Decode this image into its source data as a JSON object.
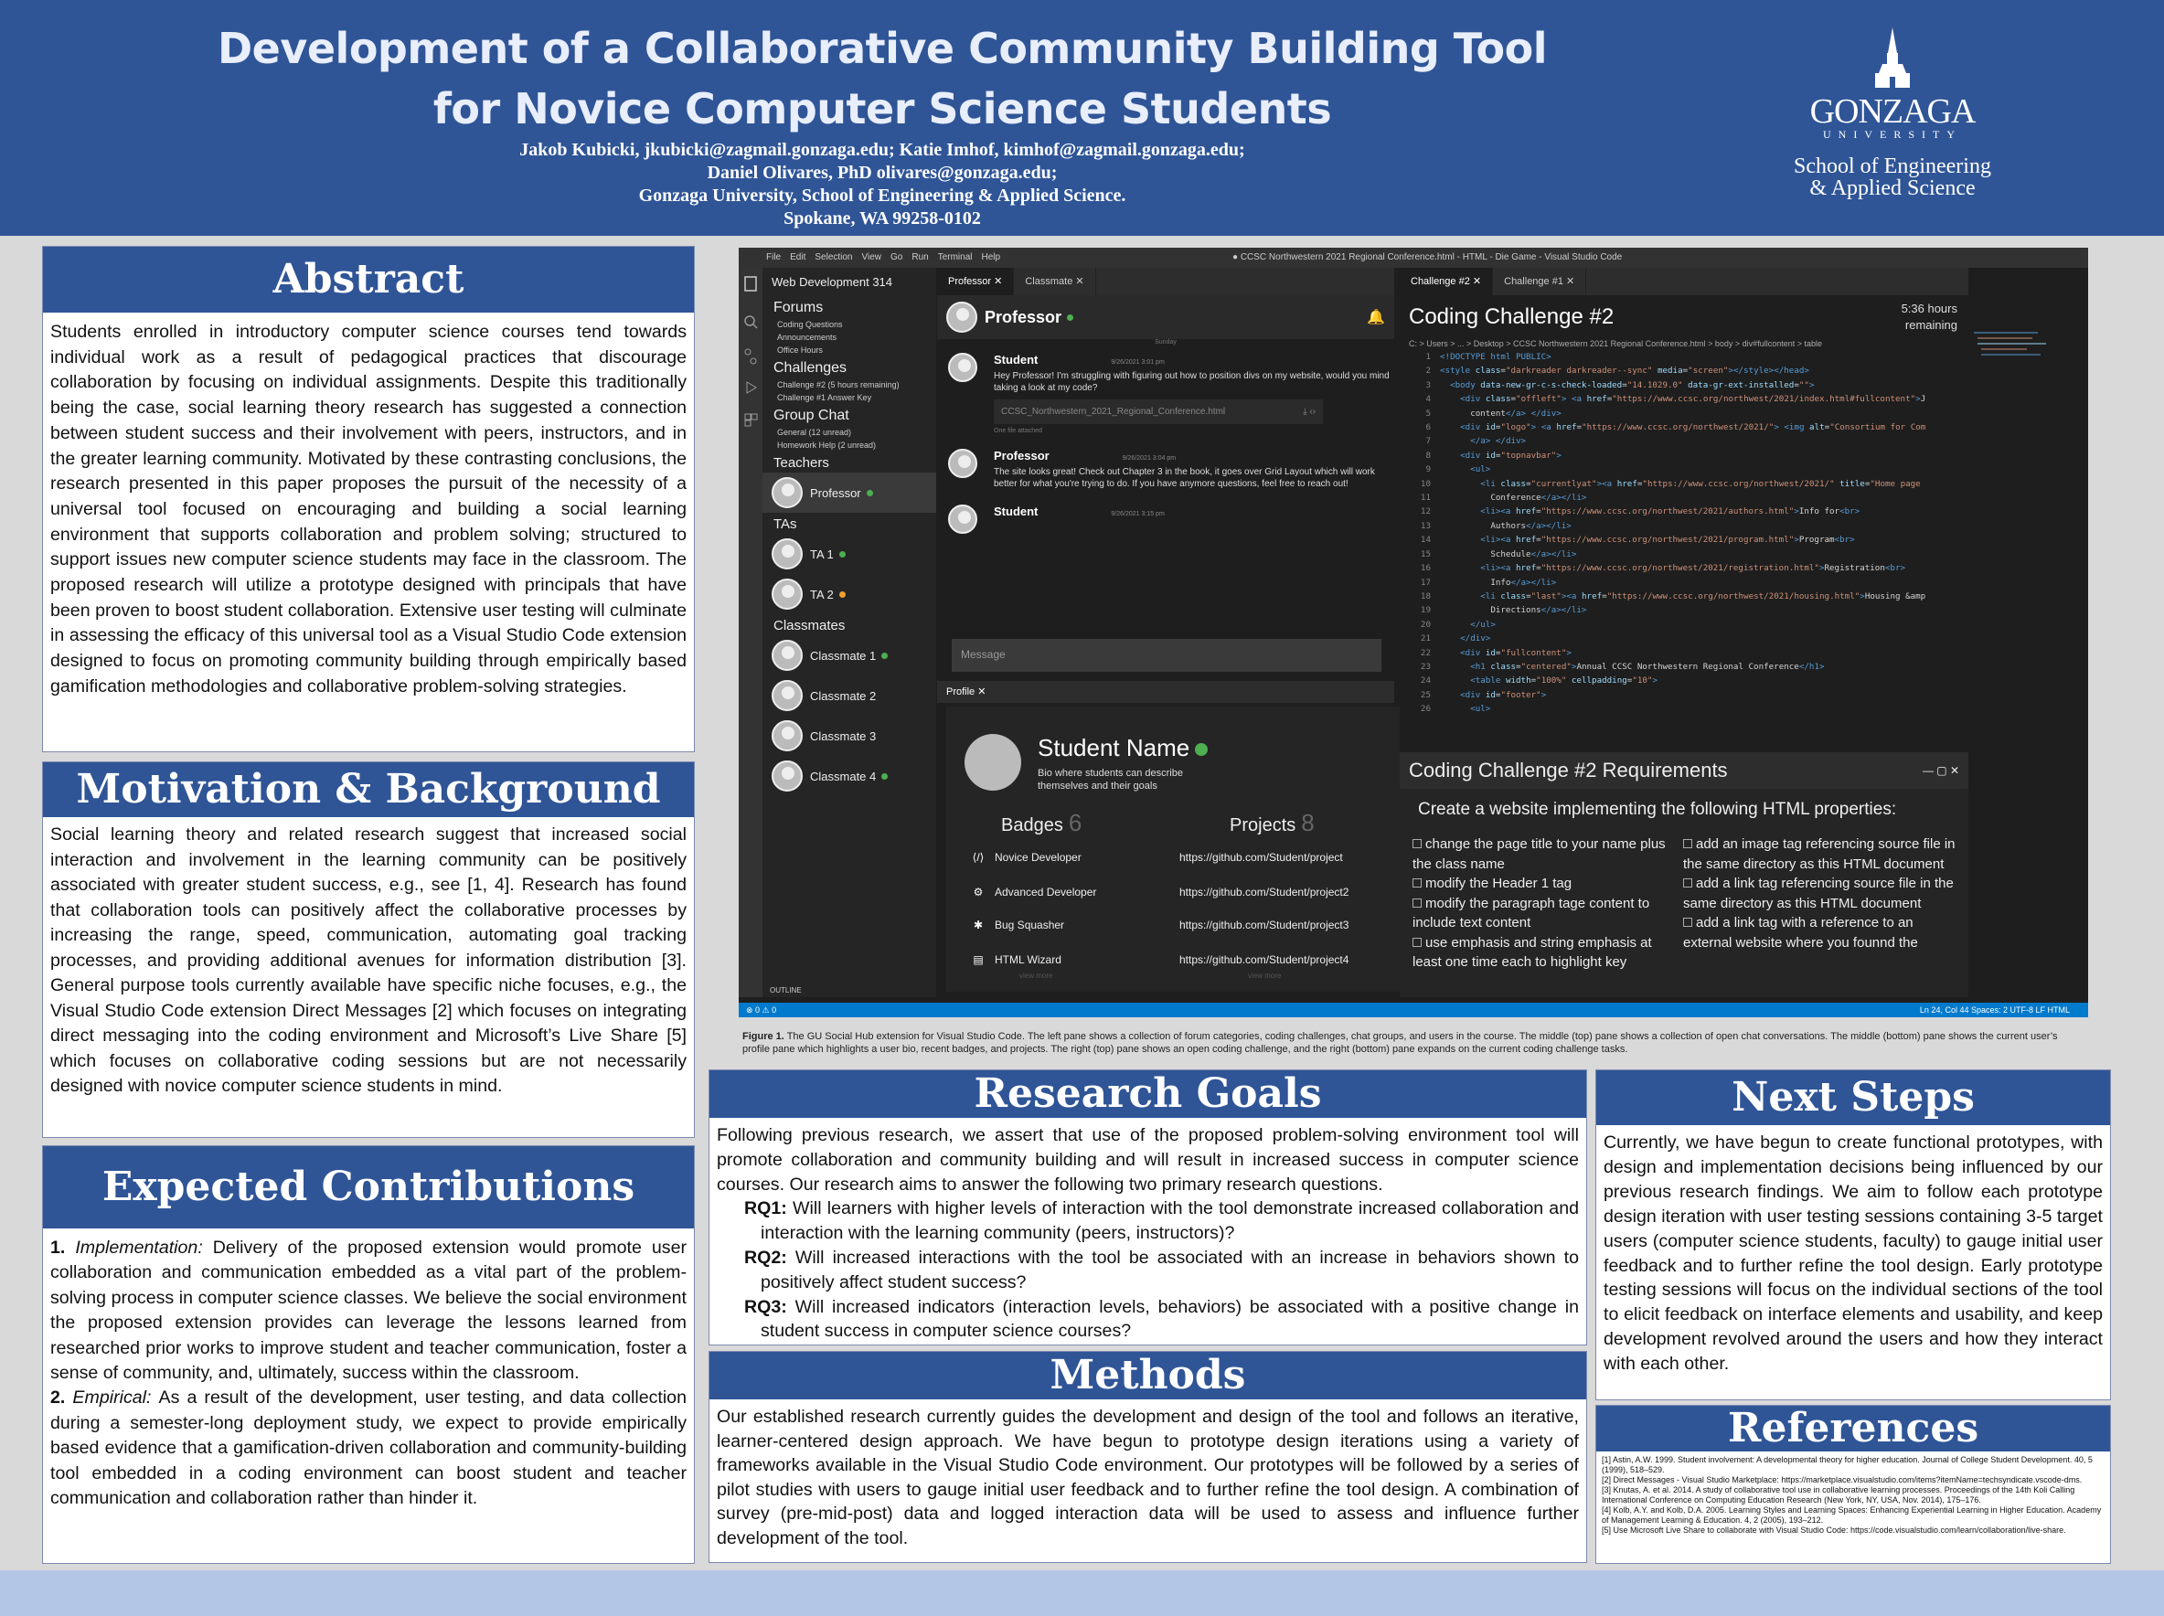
{
  "header": {
    "title_line1": "Development of a Collaborative Community Building Tool",
    "title_line2": "for Novice Computer Science Students",
    "authors_line1": "Jakob Kubicki, jkubicki@zagmail.gonzaga.edu; Katie Imhof, kimhof@zagmail.gonzaga.edu;",
    "authors_line2": "Daniel Olivares, PhD olivares@gonzaga.edu;",
    "authors_line3": "Gonzaga University, School of Engineering & Applied Science.",
    "authors_line4": "Spokane, WA 99258-0102",
    "logo_word": "GONZAGA",
    "logo_university": "UNIVERSITY",
    "logo_school_line1": "School of Engineering",
    "logo_school_line2": "& Applied Science"
  },
  "abstract": {
    "heading": "Abstract",
    "body": "Students enrolled in introductory computer science courses tend towards individual work as a result of pedagogical practices that discourage collaboration by focusing on individual assignments. Despite this traditionally being the case, social learning theory research has suggested a connection between student success and their involvement with peers, instructors, and in the greater learning community. Motivated by these contrasting conclusions, the research presented in this paper proposes the pursuit of the necessity of a universal tool focused on encouraging and building a social learning environment that supports collaboration and problem solving; structured to support issues new computer science students may face in the classroom. The proposed research will utilize a prototype designed with principals that have been proven to boost student collaboration. Extensive user testing will culminate in assessing the efficacy of this universal tool as a Visual Studio Code extension designed to focus on promoting community building through empirically based gamification methodologies and collaborative problem-solving strategies."
  },
  "motivation": {
    "heading": "Motivation & Background",
    "body": "Social learning theory and related research suggest that increased social interaction and involvement in the learning community can be positively associated with greater student success, e.g., see [1, 4]. Research has found that collaboration tools can positively affect the collaborative processes by increasing the range, speed, communication, automating goal tracking processes, and providing additional avenues for information distribution [3]. General purpose tools currently available have specific niche focuses, e.g., the Visual Studio Code extension Direct Messages [2] which focuses on integrating direct messaging into the coding environment and Microsoft’s Live Share [5] which focuses on collaborative coding sessions but are not necessarily designed with novice computer science students in mind."
  },
  "contributions": {
    "heading": "Expected Contributions",
    "item1_num": "1.",
    "item1_label": "Implementation:",
    "item1_text": " Delivery of the proposed extension would promote user collaboration and communication embedded as a vital part of the problem-solving process in computer science classes. We believe the social environment the proposed extension provides can leverage the lessons learned from researched prior works to improve student and teacher communication, foster a sense of community, and, ultimately, success within the classroom.",
    "item2_num": "2.",
    "item2_label": "Empirical: ",
    "item2_text": "As a result of the development, user testing, and data collection during a semester-long deployment study, we expect to provide empirically based evidence that a gamification-driven collaboration and community-building tool embedded in a coding environment can boost student and teacher communication and collaboration rather than hinder it."
  },
  "goals": {
    "heading": "Research Goals",
    "intro": "Following previous research, we assert that use of the proposed problem-solving environment tool will promote collaboration and community building and will result in increased success in computer science courses. Our research aims to answer the following two primary research questions.",
    "rq1_label": "RQ1:",
    "rq1_text": " Will learners with higher levels of interaction with the tool demonstrate increased collaboration and interaction with the learning community (peers, instructors)?",
    "rq2_label": "RQ2:",
    "rq2_text": " Will increased interactions with the tool be associated with an increase in behaviors shown to positively affect student success?",
    "rq3_label": "RQ3:",
    "rq3_text": " Will increased indicators (interaction levels, behaviors) be associated with a positive change in student success in computer science courses?"
  },
  "methods": {
    "heading": "Methods",
    "body": "Our established research currently guides the development and design of the tool and follows an iterative, learner-centered design approach. We have begun to prototype design iterations using a variety of frameworks available in the Visual Studio Code environment. Our prototypes will be followed by a series of pilot studies with users to gauge initial user feedback and to further refine the tool design. A combination of survey (pre-mid-post) data and logged interaction data will be used to assess and influence further development of the tool."
  },
  "next_steps": {
    "heading": "Next Steps",
    "body": "Currently, we have begun to create functional prototypes, with design and implementation decisions being influenced by our previous research findings. We aim to follow each prototype design iteration with user testing sessions containing 3-5 target users (computer science students, faculty) to gauge initial user feedback and to further refine the tool design. Early prototype testing sessions will focus on the individual sections of the tool to elicit feedback on interface elements and usability, and keep development revolved around the users and how they interact with each other."
  },
  "references": {
    "heading": "References",
    "items": [
      "[1] Astin, A.W. 1999. Student involvement: A developmental theory for higher education. Journal of College Student Development. 40, 5 (1999), 518–529.",
      "[2] Direct Messages - Visual Studio Marketplace: https://marketplace.visualstudio.com/items?itemName=techsyndicate.vscode-dms.",
      "[3] Knutas, A. et al. 2014. A study of collaborative tool use in collaborative learning processes. Proceedings of the 14th Koli Calling International Conference on Computing Education Research (New York, NY, USA, Nov. 2014), 175–176.",
      "[4] Kolb, A.Y. and Kolb, D.A. 2005. Learning Styles and Learning Spaces: Enhancing Experiential Learning in Higher Education. Academy of Management Learning & Education. 4, 2 (2005), 193–212.",
      "[5] Use Microsoft Live Share to collaborate with Visual Studio Code: https://code.visualstudio.com/learn/collaboration/live-share."
    ]
  },
  "figure": {
    "caption_label": "Figure 1.",
    "caption_text": " The GU Social Hub extension for Visual Studio Code. The left pane shows a collection of forum categories, coding challenges, chat groups, and users in the course. The middle (top) pane shows a collection of open chat conversations. The middle (bottom) pane shows the current user’s profile pane which highlights a user bio, recent badges, and projects. The right (top) pane shows an open coding challenge, and the right (bottom) pane expands on the current coding challenge tasks.",
    "menu": [
      "File",
      "Edit",
      "Selection",
      "View",
      "Go",
      "Run",
      "Terminal",
      "Help"
    ],
    "window_title": "● CCSC Northwestern 2021 Regional Conference.html - HTML - Die Game - Visual Studio Code",
    "sidebar": {
      "title": "Web Development 314",
      "forums": "Forums",
      "forum_items": [
        "Coding Questions",
        "Announcements",
        "Office Hours"
      ],
      "challenges": "Challenges",
      "challenge_items": [
        "Challenge #2 (5 hours remaining)",
        "Challenge #1 Answer Key"
      ],
      "group_chat": "Group Chat",
      "group_items": [
        "General (12 unread)",
        "Homework Help (2 unread)"
      ],
      "teachers": "Teachers",
      "teacher_name": "Professor",
      "tas": "TAs",
      "ta1": "TA 1",
      "ta2": "TA 2",
      "classmates": "Classmates",
      "classmate_items": [
        "Classmate 1",
        "Classmate 2",
        "Classmate 3",
        "Classmate 4"
      ]
    },
    "chat": {
      "tab1": "Professor",
      "tab2": "Classmate",
      "header_name": "Professor",
      "day": "Sunday",
      "msg1_name": "Student",
      "msg1_time": "9/26/2021 3:01 pm",
      "msg1_text": "Hey Professor! I'm struggling with figuring out how to position divs on my website, would you mind taking a look at my code?",
      "msg1_file": "CCSC_Northwestern_2021_Regional_Conference.html",
      "msg1_attached": "One file attached",
      "msg2_name": "Professor",
      "msg2_time": "9/26/2021 3:04 pm",
      "msg2_text": "The site looks great! Check out Chapter 3 in the book, it goes over Grid Layout which will work better for what you're trying to do. If you have anymore questions, feel free to reach out!",
      "msg3_name": "Student",
      "msg3_time": "9/26/2021 3:15 pm",
      "input_placeholder": "Message"
    },
    "profile": {
      "tab": "Profile",
      "name": "Student Name",
      "bio": "Bio where students can describe themselves and their goals",
      "badges_label": "Badges",
      "badges_count": "6",
      "projects_label": "Projects",
      "projects_count": "8",
      "badges": [
        "Novice Developer",
        "Advanced Developer",
        "Bug Squasher",
        "HTML Wizard"
      ],
      "projects": [
        "https://github.com/Student/project",
        "https://github.com/Student/project2",
        "https://github.com/Student/project3",
        "https://github.com/Student/project4"
      ],
      "view_more": "view more"
    },
    "challenge": {
      "tab1": "Challenge #2",
      "tab2": "Challenge #1",
      "title": "Coding Challenge #2",
      "time_line1": "5:36 hours",
      "time_line2": "remaining",
      "breadcrumb": "C: > Users > ... > Desktop > CCSC Northwestern 2021 Regional Conference.html > body > div#fullcontent > table"
    },
    "requirements": {
      "title": "Coding Challenge #2 Requirements",
      "heading": "Create a website implementing the following HTML properties:",
      "left": [
        "change the page title to your name plus the class name",
        "modify the Header 1 tag",
        "modify the paragraph tage content to include text content",
        "use emphasis and string emphasis at least one time each to highlight key"
      ],
      "right": [
        "add an image tag referencing source file in the same directory as this HTML document",
        "add a link tag referencing source file in the same directory as this HTML document",
        "add a link tag with a reference to an external website where you founnd the"
      ]
    },
    "status": {
      "left": "⊗ 0 ⚠ 0",
      "outline": "OUTLINE",
      "right": "Ln 24, Col 44   Spaces: 2   UTF-8   LF   HTML"
    }
  }
}
